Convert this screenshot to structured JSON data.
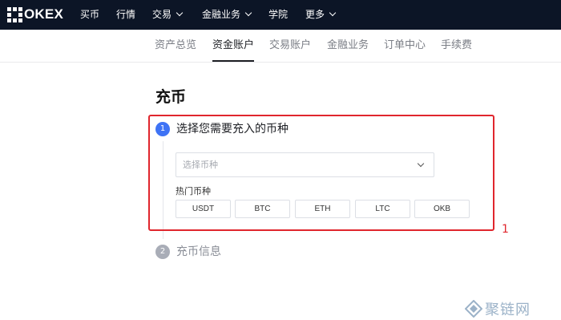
{
  "brand": {
    "name": "OKEX"
  },
  "top_nav": {
    "items": [
      {
        "label": "买币",
        "has_dropdown": false
      },
      {
        "label": "行情",
        "has_dropdown": false
      },
      {
        "label": "交易",
        "has_dropdown": true
      },
      {
        "label": "金融业务",
        "has_dropdown": true
      },
      {
        "label": "学院",
        "has_dropdown": false
      },
      {
        "label": "更多",
        "has_dropdown": true
      }
    ]
  },
  "sub_nav": {
    "items": [
      {
        "label": "资产总览",
        "active": false
      },
      {
        "label": "资金账户",
        "active": true
      },
      {
        "label": "交易账户",
        "active": false
      },
      {
        "label": "金融业务",
        "active": false
      },
      {
        "label": "订单中心",
        "active": false
      },
      {
        "label": "手续费",
        "active": false
      }
    ]
  },
  "page": {
    "title": "充币"
  },
  "steps": [
    {
      "number": "1",
      "label": "选择您需要充入的币种",
      "active": true
    },
    {
      "number": "2",
      "label": "充币信息",
      "active": false
    }
  ],
  "coin_select": {
    "placeholder": "选择币种"
  },
  "hot_coins": {
    "label": "热门币种",
    "items": [
      "USDT",
      "BTC",
      "ETH",
      "LTC",
      "OKB"
    ]
  },
  "annotation": {
    "label": "1"
  },
  "watermark": {
    "text": "聚链网"
  },
  "colors": {
    "topbar_bg": "#0c1526",
    "step_active": "#3e73f5",
    "step_inactive": "#a9adb7",
    "highlight": "#e0262d"
  }
}
